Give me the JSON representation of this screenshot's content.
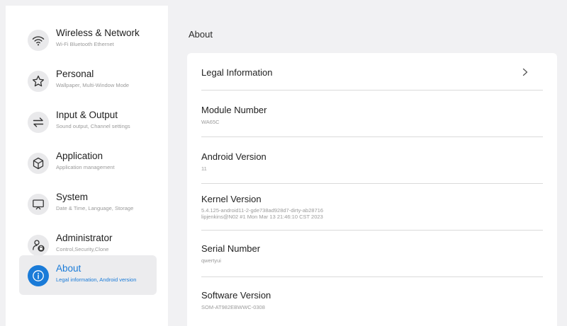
{
  "colors": {
    "accent": "#1a7bd8",
    "background": "#f1f1f3",
    "panel": "#ffffff",
    "active_item_bg": "#ececee",
    "subtitle": "#9a9a9a"
  },
  "sidebar": {
    "items": [
      {
        "icon": "wifi-icon",
        "title": "Wireless & Network",
        "subtitle": "Wi-Fi Bluetooth Ethernet",
        "active": false
      },
      {
        "icon": "star-icon",
        "title": "Personal",
        "subtitle": "Wallpaper, Multi-Window Mode",
        "active": false
      },
      {
        "icon": "swap-arrows-icon",
        "title": "Input & Output",
        "subtitle": "Sound output, Channel settings",
        "active": false
      },
      {
        "icon": "cube-icon",
        "title": "Application",
        "subtitle": "Application management",
        "active": false
      },
      {
        "icon": "monitor-icon",
        "title": "System",
        "subtitle": "Date & Time, Language, Storage",
        "active": false
      },
      {
        "icon": "admin-lock-icon",
        "title": "Administrator",
        "subtitle": "Control,Security,Clone",
        "active": false
      },
      {
        "icon": "info-icon",
        "title": "About",
        "subtitle": "Legal information, Android version",
        "active": true
      }
    ]
  },
  "main": {
    "section_title": "About",
    "rows": [
      {
        "title": "Legal Information",
        "has_chevron": true
      },
      {
        "title": "Module Number",
        "value": "WA65C"
      },
      {
        "title": "Android Version",
        "value": "11"
      },
      {
        "title": "Kernel Version",
        "value_line1": "5.4.125-android11-2-gde738ad928d7-dirty-ab28716",
        "value_line2": "lipjenkins@N02 #1 Mon Mar 13 21:46:10 CST 2023"
      },
      {
        "title": "Serial Number",
        "value": "qwertyui"
      },
      {
        "title": "Software Version",
        "value": "SOM-AT982EBWWC-0308"
      }
    ]
  }
}
